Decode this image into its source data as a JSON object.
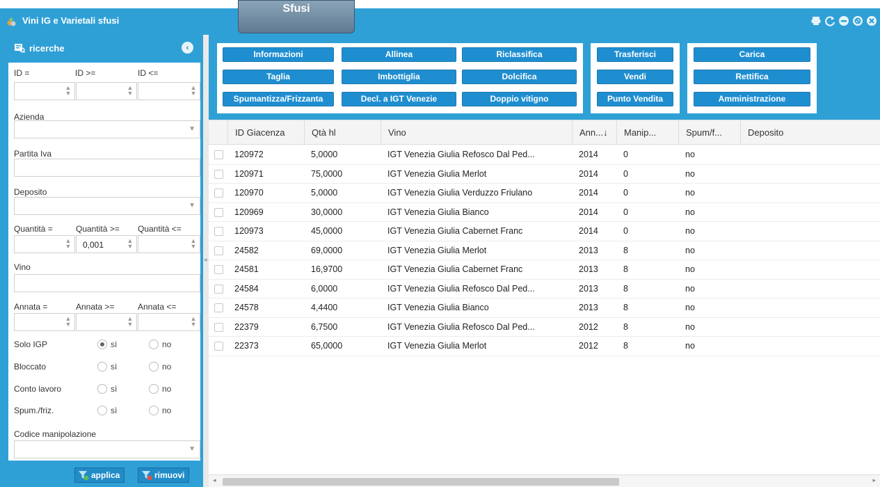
{
  "window": {
    "title": "Vini IG e Varietali sfusi",
    "tab_label": "Sfusi"
  },
  "colors": {
    "accent": "#2fa0d6",
    "button": "#1f8ed0"
  },
  "search_panel": {
    "title": "ricerche",
    "labels": {
      "id_eq": "ID =",
      "id_gte": "ID >=",
      "id_lte": "ID <=",
      "azienda": "Azienda",
      "partita_iva": "Partita Iva",
      "deposito": "Deposito",
      "qty_eq": "Quantità =",
      "qty_gte": "Quantità >=",
      "qty_lte": "Quantità <=",
      "vino": "Vino",
      "annata_eq": "Annata =",
      "annata_gte": "Annata >=",
      "annata_lte": "Annata <=",
      "solo_igp": "Solo IGP",
      "bloccato": "Bloccato",
      "conto_lavoro": "Conto lavoro",
      "spum_friz": "Spum./friz.",
      "codice_manip": "Codice manipolazione",
      "si": "sì",
      "no": "no"
    },
    "values": {
      "qty_gte": "0,001"
    },
    "apply_label": "applica",
    "remove_label": "rimuovi"
  },
  "toolbar": {
    "informazioni": "Informazioni",
    "allinea": "Allinea",
    "riclassifica": "Riclassifica",
    "taglia": "Taglia",
    "imbottiglia": "Imbottiglia",
    "dolcifica": "Dolcifica",
    "spumantizza": "Spumantizza/Frizzanta",
    "decl_igt": "Decl. a IGT Venezie",
    "doppio_vitigno": "Doppio vitigno",
    "trasferisci": "Trasferisci",
    "vendi": "Vendi",
    "punto_vendita": "Punto Vendita",
    "carica": "Carica",
    "rettifica": "Rettifica",
    "amministrazione": "Amministrazione"
  },
  "grid": {
    "columns": [
      "ID Giacenza",
      "Qtà hl",
      "Vino",
      "Ann...↓",
      "Manip...",
      "Spum/f...",
      "Deposito"
    ],
    "rows": [
      [
        "120972",
        "5,0000",
        "IGT Venezia Giulia Refosco Dal Ped...",
        "2014",
        "0",
        "no"
      ],
      [
        "120971",
        "75,0000",
        "IGT Venezia Giulia Merlot",
        "2014",
        "0",
        "no"
      ],
      [
        "120970",
        "5,0000",
        "IGT Venezia Giulia Verduzzo Friulano",
        "2014",
        "0",
        "no"
      ],
      [
        "120969",
        "30,0000",
        "IGT Venezia Giulia Bianco",
        "2014",
        "0",
        "no"
      ],
      [
        "120973",
        "45,0000",
        "IGT Venezia Giulia Cabernet Franc",
        "2014",
        "0",
        "no"
      ],
      [
        "24582",
        "69,0000",
        "IGT Venezia Giulia Merlot",
        "2013",
        "8",
        "no"
      ],
      [
        "24581",
        "16,9700",
        "IGT Venezia Giulia Cabernet Franc",
        "2013",
        "8",
        "no"
      ],
      [
        "24584",
        "6,0000",
        "IGT Venezia Giulia Refosco Dal Ped...",
        "2013",
        "8",
        "no"
      ],
      [
        "24578",
        "4,4400",
        "IGT Venezia Giulia Bianco",
        "2013",
        "8",
        "no"
      ],
      [
        "22379",
        "6,7500",
        "IGT Venezia Giulia Refosco Dal Ped...",
        "2012",
        "8",
        "no"
      ],
      [
        "22373",
        "65,0000",
        "IGT Venezia Giulia Merlot",
        "2012",
        "8",
        "no"
      ]
    ]
  }
}
